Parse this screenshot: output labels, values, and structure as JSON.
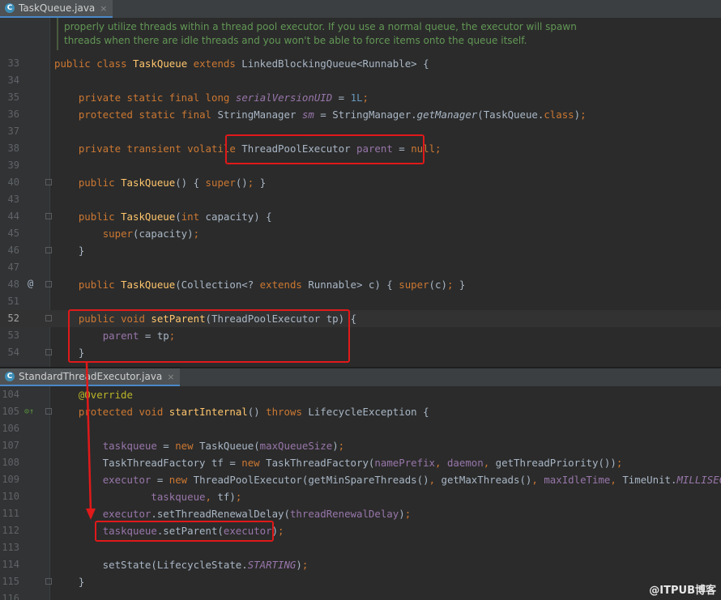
{
  "tab1": {
    "filename": "TaskQueue.java",
    "close": "×"
  },
  "tab2": {
    "filename": "StandardThreadExecutor.java",
    "close": "×"
  },
  "doc_comment": {
    "line1": "properly utilize threads within a thread pool executor. If you use a normal queue, the executor will spawn",
    "line2": "threads when there are idle threads and you won't be able to force items onto the queue itself."
  },
  "pane1_lines": [
    {
      "n": "33",
      "t": "public class TaskQueue extends LinkedBlockingQueue<Runnable> {"
    },
    {
      "n": "34",
      "t": ""
    },
    {
      "n": "35",
      "t": "    private static final long serialVersionUID = 1L;"
    },
    {
      "n": "36",
      "t": "    protected static final StringManager sm = StringManager.getManager(TaskQueue.class);"
    },
    {
      "n": "37",
      "t": ""
    },
    {
      "n": "38",
      "t": "    private transient volatile ThreadPoolExecutor parent = null;"
    },
    {
      "n": "39",
      "t": ""
    },
    {
      "n": "40",
      "t": "    public TaskQueue() { super(); }"
    },
    {
      "n": "43",
      "t": ""
    },
    {
      "n": "44",
      "t": "    public TaskQueue(int capacity) {"
    },
    {
      "n": "45",
      "t": "        super(capacity);"
    },
    {
      "n": "46",
      "t": "    }"
    },
    {
      "n": "47",
      "t": ""
    },
    {
      "n": "48",
      "t": "    public TaskQueue(Collection<? extends Runnable> c) { super(c); }"
    },
    {
      "n": "51",
      "t": ""
    },
    {
      "n": "52",
      "t": "    public void setParent(ThreadPoolExecutor tp) {"
    },
    {
      "n": "53",
      "t": "        parent = tp;"
    },
    {
      "n": "54",
      "t": "    }"
    }
  ],
  "pane2_lines": [
    {
      "n": "104",
      "t": "    @Override"
    },
    {
      "n": "105",
      "t": "    protected void startInternal() throws LifecycleException {"
    },
    {
      "n": "106",
      "t": ""
    },
    {
      "n": "107",
      "t": "        taskqueue = new TaskQueue(maxQueueSize);"
    },
    {
      "n": "108",
      "t": "        TaskThreadFactory tf = new TaskThreadFactory(namePrefix, daemon, getThreadPriority());"
    },
    {
      "n": "109",
      "t": "        executor = new ThreadPoolExecutor(getMinSpareThreads(), getMaxThreads(), maxIdleTime, TimeUnit.MILLISECONDS,"
    },
    {
      "n": "110",
      "t": "                taskqueue, tf);"
    },
    {
      "n": "111",
      "t": "        executor.setThreadRenewalDelay(threadRenewalDelay);"
    },
    {
      "n": "112",
      "t": "        taskqueue.setParent(executor);"
    },
    {
      "n": "113",
      "t": ""
    },
    {
      "n": "114",
      "t": "        setState(LifecycleState.STARTING);"
    },
    {
      "n": "115",
      "t": "    }"
    },
    {
      "n": "116",
      "t": ""
    }
  ],
  "gutter": {
    "override_marker": "@",
    "implements_marker": "⊙↑"
  },
  "watermark": "@ITPUB博客",
  "colors": {
    "keyword": "#cc7832",
    "method": "#ffc66d",
    "field": "#9876aa",
    "number": "#6897bb",
    "annotation": "#bbb529",
    "comment": "#629755",
    "default": "#a9b7c6",
    "highlight": "#e0191a"
  }
}
